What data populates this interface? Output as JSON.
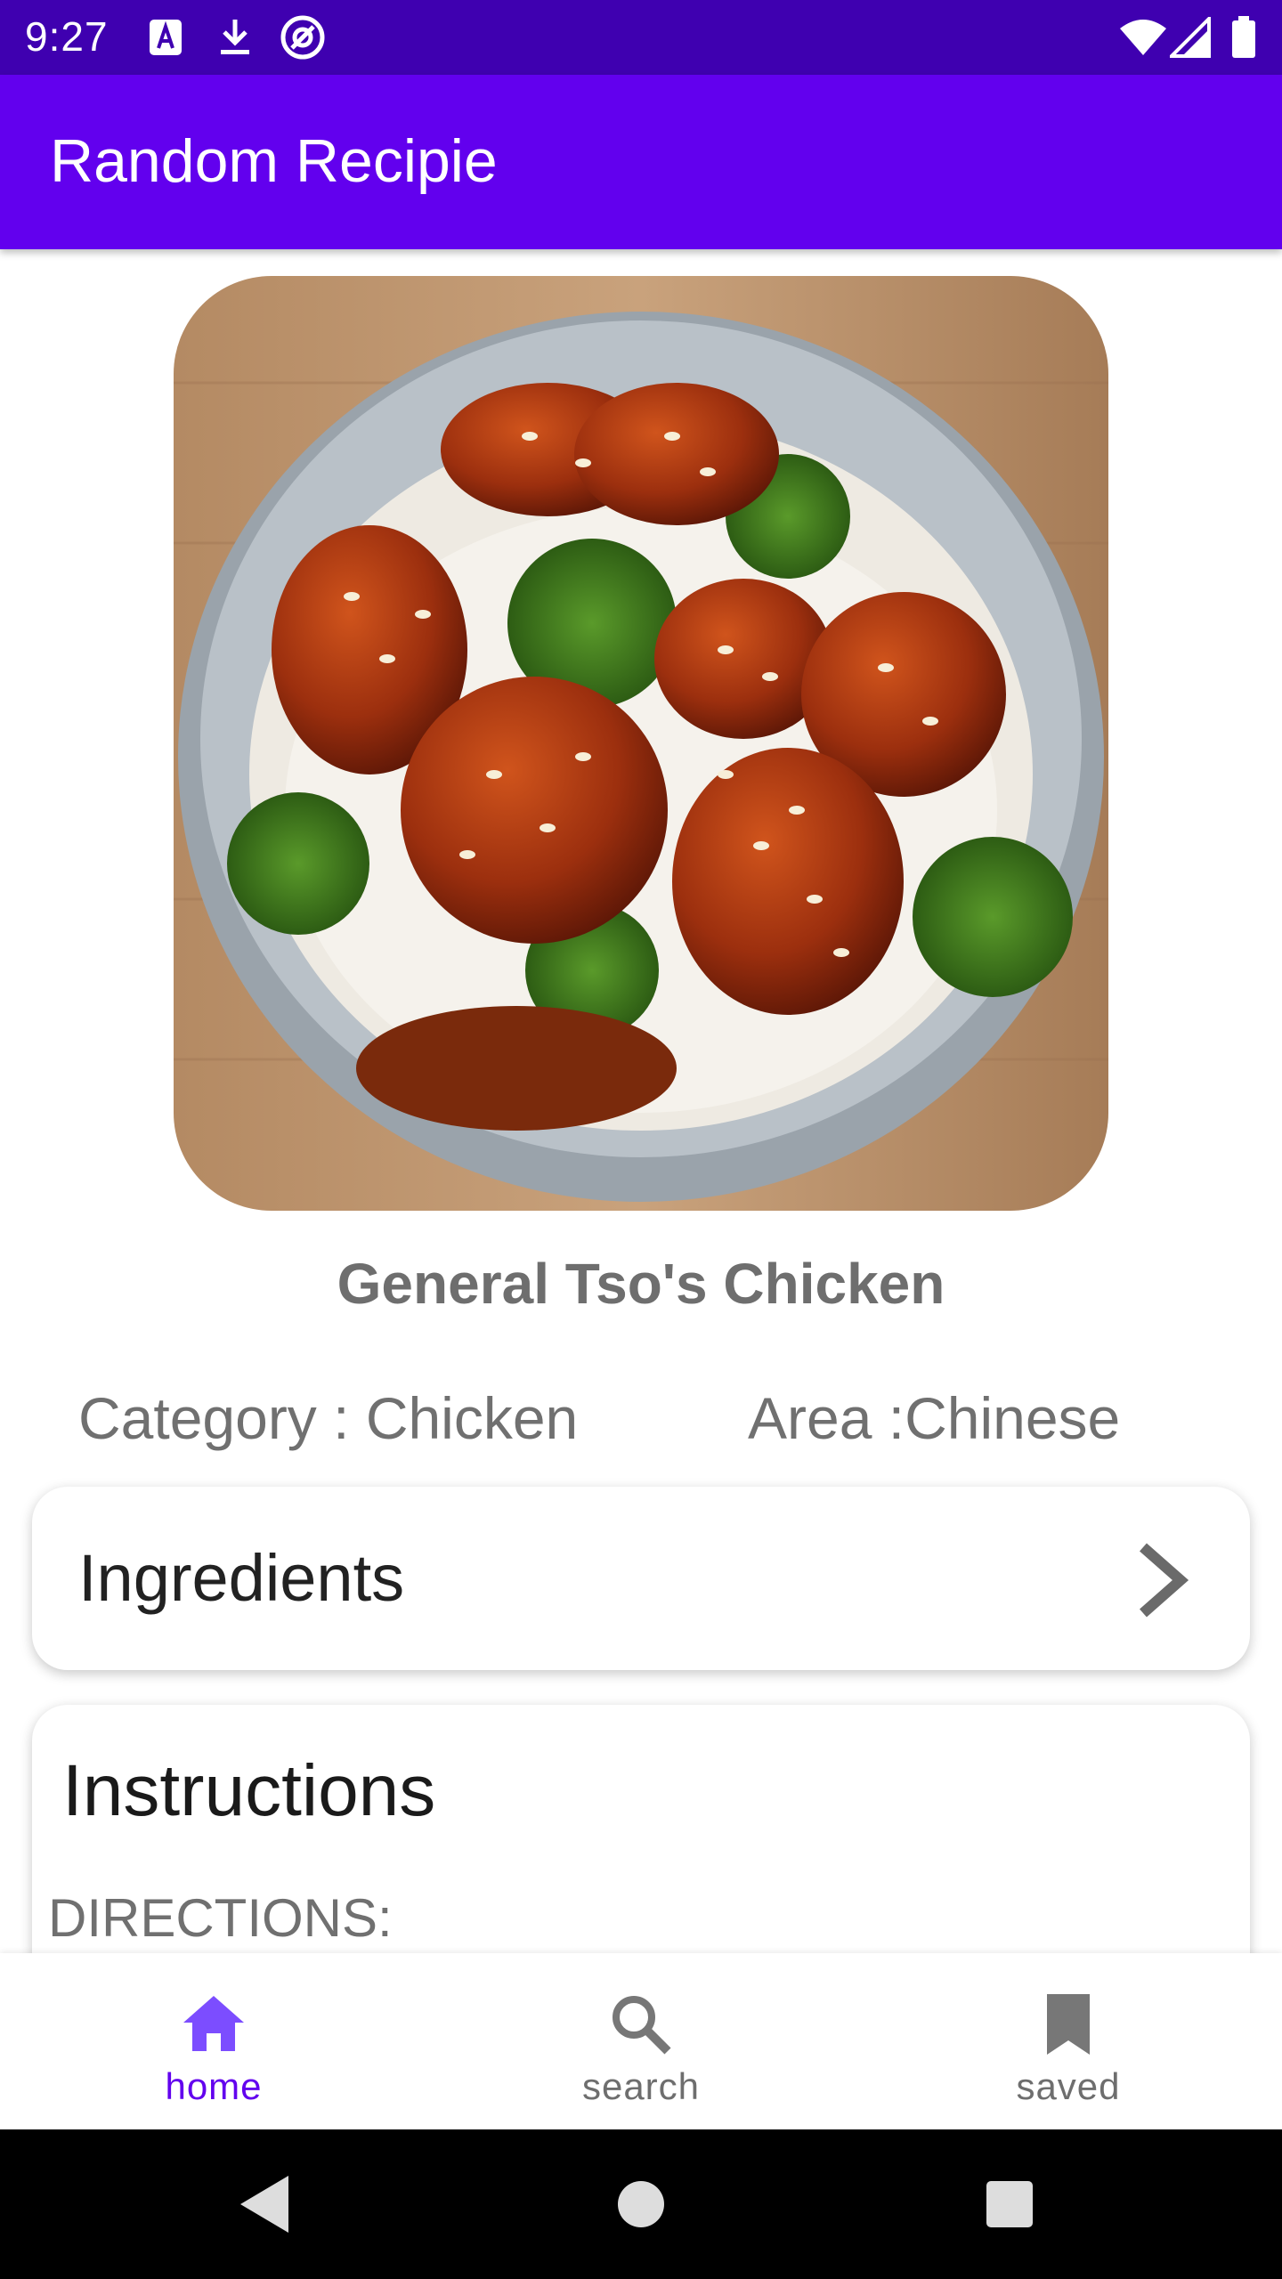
{
  "status_bar": {
    "time": "9:27",
    "icons": [
      "a-letter-icon",
      "download-icon",
      "at-sign-icon",
      "wifi-icon",
      "signal-icon",
      "battery-icon"
    ]
  },
  "app_bar": {
    "title": "Random Recipie"
  },
  "recipe": {
    "name": "General Tso's Chicken",
    "category": "Category : Chicken",
    "area": "Area :Chinese",
    "ingredients_label": "Ingredients",
    "instructions_label": "Instructions",
    "directions_label": "DIRECTIONS:"
  },
  "bottom_nav": {
    "items": [
      {
        "label": "home",
        "icon": "home-icon",
        "active": true
      },
      {
        "label": "search",
        "icon": "search-icon",
        "active": false
      },
      {
        "label": "saved",
        "icon": "bookmark-icon",
        "active": false
      }
    ]
  },
  "colors": {
    "status_bar": "#3f00b0",
    "app_bar": "#6200ee",
    "active_nav": "#6200ee",
    "inactive_nav": "#6e6e6e"
  }
}
